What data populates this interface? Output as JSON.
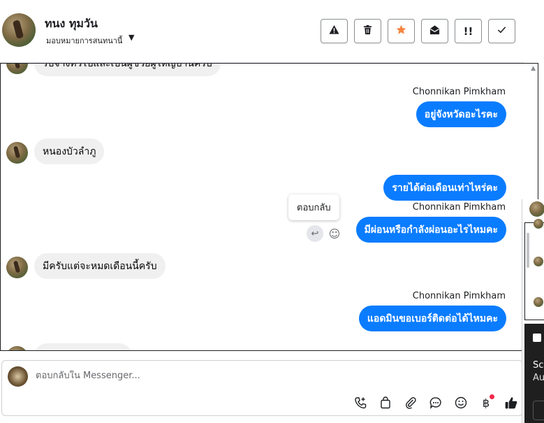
{
  "header": {
    "contact_name": "ทนง ทุมวัน",
    "assign_label": "มอบหมายการสนทนานี้",
    "toolbar": [
      {
        "name": "report-spam-button",
        "icon": "warning-icon"
      },
      {
        "name": "delete-button",
        "icon": "trash-icon"
      },
      {
        "name": "star-button",
        "icon": "star-icon"
      },
      {
        "name": "mark-unread-button",
        "icon": "envelope-open-icon"
      },
      {
        "name": "mark-important-button",
        "icon": "exclamation-icon"
      },
      {
        "name": "mark-done-button",
        "icon": "check-icon"
      }
    ]
  },
  "colors": {
    "accent": "#0a7cff",
    "incoming_bubble": "#f0f0f0",
    "star": "#f5853f",
    "notification": "#f02849"
  },
  "messages": {
    "m0": {
      "text": "รับจ้างทั่วไปและเป็นผู้ช่วยผู้ใหญ่บ้านครับ"
    },
    "m1": {
      "sender": "Chonnikan Pimkham",
      "text": "อยู่จังหวัดอะไรคะ"
    },
    "m2": {
      "text": "หนองบัวลำภู"
    },
    "m3": {
      "text": "รายได้ต่อเดือนเท่าไหร่คะ"
    },
    "m4": {
      "sender": "Chonnikan Pimkham",
      "text": "มีผ่อนหรือกำลังผ่อนอะไรไหมคะ"
    },
    "m5": {
      "text": "มีครับแต่จะหมดเดือนนี้ครับ"
    },
    "m6": {
      "sender": "Chonnikan Pimkham",
      "text": "แอดมินขอเบอร์ติดต่อได้ไหมคะ"
    }
  },
  "tooltip": {
    "text": "ตอบกลับ"
  },
  "composer": {
    "placeholder": "ตอบกลับใน Messenger...",
    "tools": [
      "call-add-icon",
      "shopping-bag-icon",
      "paperclip-icon",
      "saved-reply-icon",
      "emoji-icon",
      "baht-icon",
      "thumbs-up-icon"
    ]
  },
  "side_panel": {
    "text_line1": "Scr",
    "text_line2": "Au"
  }
}
